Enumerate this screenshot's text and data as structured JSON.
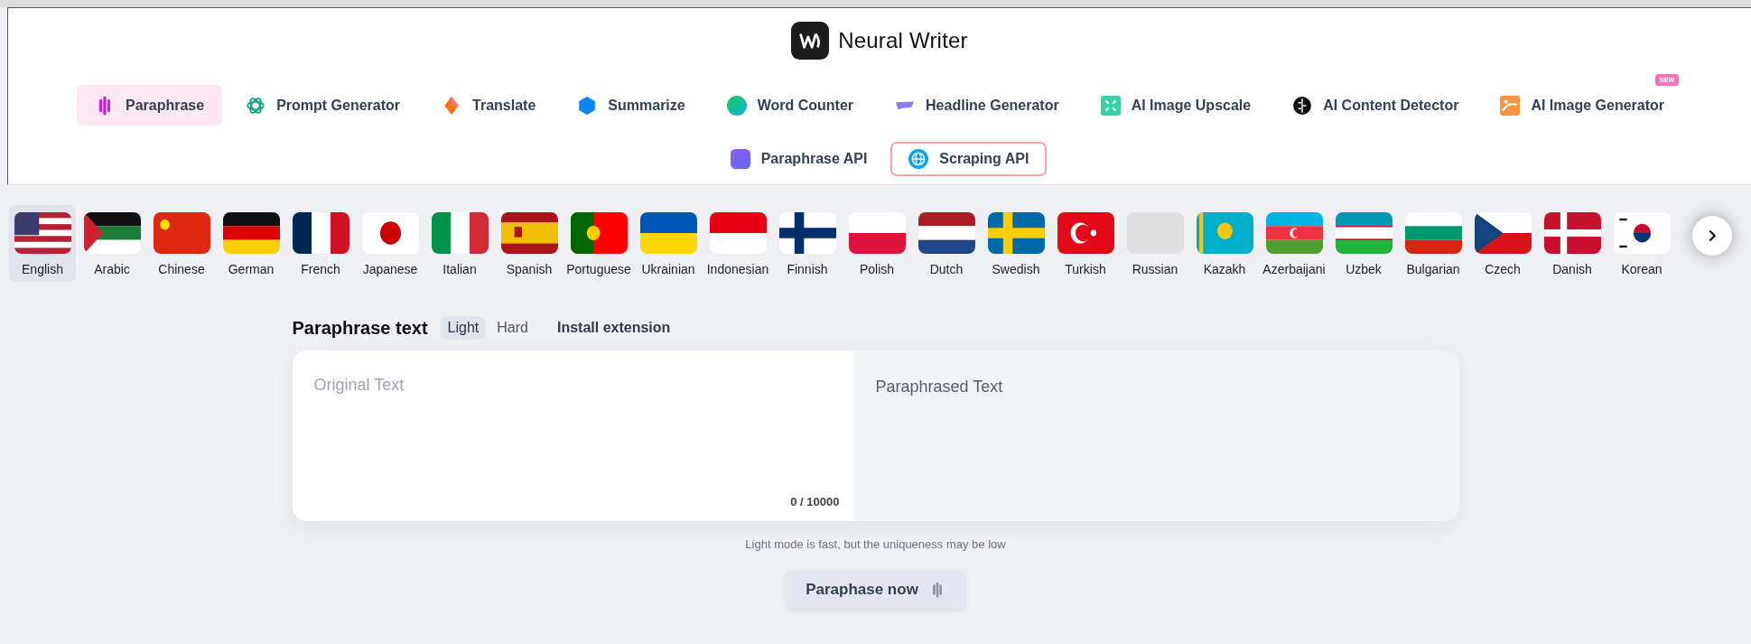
{
  "brand": {
    "name": "Neural Writer"
  },
  "nav": [
    {
      "label": "Paraphrase",
      "kind": "paraphrase",
      "selected": true,
      "outlined": false
    },
    {
      "label": "Prompt Generator",
      "kind": "prompt",
      "selected": false,
      "outlined": false
    },
    {
      "label": "Translate",
      "kind": "translate",
      "selected": false,
      "outlined": false
    },
    {
      "label": "Summarize",
      "kind": "summarize",
      "selected": false,
      "outlined": false
    },
    {
      "label": "Word Counter",
      "kind": "counter",
      "selected": false,
      "outlined": false
    },
    {
      "label": "Headline Generator",
      "kind": "headline",
      "selected": false,
      "outlined": false
    },
    {
      "label": "AI Image Upscale",
      "kind": "upscale",
      "selected": false,
      "outlined": false
    },
    {
      "label": "AI Content Detector",
      "kind": "detector",
      "selected": false,
      "outlined": false
    },
    {
      "label": "AI Image Generator",
      "kind": "imagegen",
      "selected": false,
      "outlined": false,
      "badge": "NEW"
    },
    {
      "label": "Paraphrase API",
      "kind": "api",
      "selected": false,
      "outlined": false
    },
    {
      "label": "Scraping API",
      "kind": "globe",
      "selected": false,
      "outlined": true
    }
  ],
  "languages": [
    {
      "label": "English",
      "kind": "us",
      "selected": true
    },
    {
      "label": "Arabic",
      "kind": "ps",
      "selected": false
    },
    {
      "label": "Chinese",
      "kind": "cn",
      "selected": false
    },
    {
      "label": "German",
      "kind": "de",
      "selected": false
    },
    {
      "label": "French",
      "kind": "fr",
      "selected": false
    },
    {
      "label": "Japanese",
      "kind": "jp",
      "selected": false
    },
    {
      "label": "Italian",
      "kind": "it",
      "selected": false
    },
    {
      "label": "Spanish",
      "kind": "es",
      "selected": false
    },
    {
      "label": "Portuguese",
      "kind": "pt",
      "selected": false
    },
    {
      "label": "Ukrainian",
      "kind": "ua",
      "selected": false
    },
    {
      "label": "Indonesian",
      "kind": "id",
      "selected": false
    },
    {
      "label": "Finnish",
      "kind": "fi",
      "selected": false
    },
    {
      "label": "Polish",
      "kind": "pl",
      "selected": false
    },
    {
      "label": "Dutch",
      "kind": "nl",
      "selected": false
    },
    {
      "label": "Swedish",
      "kind": "se",
      "selected": false
    },
    {
      "label": "Turkish",
      "kind": "tr",
      "selected": false
    },
    {
      "label": "Russian",
      "kind": "blank",
      "selected": false
    },
    {
      "label": "Kazakh",
      "kind": "kz",
      "selected": false
    },
    {
      "label": "Azerbaijani",
      "kind": "az",
      "selected": false
    },
    {
      "label": "Uzbek",
      "kind": "uz",
      "selected": false
    },
    {
      "label": "Bulgarian",
      "kind": "bg",
      "selected": false
    },
    {
      "label": "Czech",
      "kind": "cz",
      "selected": false
    },
    {
      "label": "Danish",
      "kind": "dk",
      "selected": false
    },
    {
      "label": "Korean",
      "kind": "kr",
      "selected": false
    }
  ],
  "editor": {
    "title": "Paraphrase text",
    "modes": [
      {
        "label": "Light",
        "selected": true
      },
      {
        "label": "Hard",
        "selected": false
      }
    ],
    "install_link": "Install extension",
    "input": {
      "placeholder": "Original Text",
      "counter": "0 / 10000"
    },
    "output": {
      "placeholder": "Paraphrased Text"
    },
    "note": "Light mode is fast, but the uniqueness may be low",
    "button": "Paraphase now"
  }
}
